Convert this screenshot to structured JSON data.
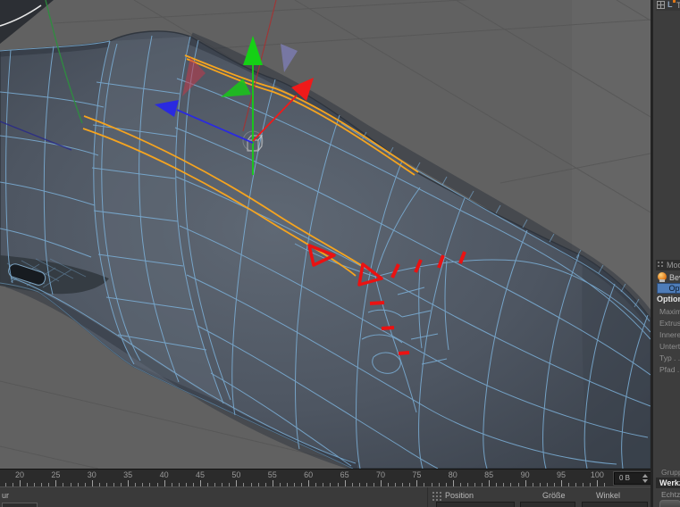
{
  "viewport": {
    "description": "perspective view of polygonal mesh with bevel tool active"
  },
  "timeline": {
    "tick_start": 20,
    "tick_end": 100,
    "tick_step": 5,
    "labels": [
      20,
      25,
      30,
      35,
      40,
      45,
      50,
      55,
      60,
      65,
      70,
      75,
      80,
      85,
      90,
      95,
      100
    ],
    "frame_value": "0 B"
  },
  "status_bar": {
    "text": "ur"
  },
  "coordinate_bar": {
    "headers": [
      "Position",
      "Größe",
      "Winkel"
    ]
  },
  "attribute_panel": {
    "tabs_text": "Tr",
    "mode_header": "Mod",
    "tool_name": "Bev",
    "active_tab": "Opt",
    "section_title": "Optione",
    "fields": [
      "Maxima",
      "Extrusi",
      "Innerer",
      "Unterte",
      "Typ . .",
      "Pfad . ."
    ],
    "group_label": "Gruppe",
    "tool_section": "Werkze",
    "realtime_label": "Echtzei"
  },
  "colors": {
    "selection_orange": "#f5a41f",
    "wireframe_blue": "#7cb0d8",
    "indicator_red": "#ea1212",
    "axis_x_red": "#ef1a1a",
    "axis_y_green": "#15d015",
    "axis_z_blue": "#2a2ae0",
    "active_tab_blue": "#4e7cb8",
    "viewport_bg": "#616161"
  }
}
